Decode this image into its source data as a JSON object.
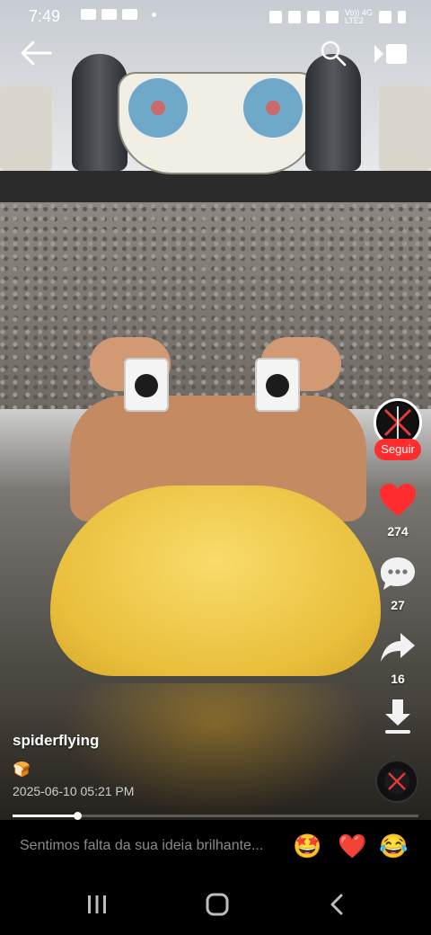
{
  "status_bar": {
    "time": "7:49",
    "network": "Vo)) 4G\nLTE2"
  },
  "top_bar": {
    "back_icon": "arrow-left-icon",
    "search_icon": "search-icon",
    "camera_icon": "video-camera-icon"
  },
  "sidebar": {
    "follow_label": "Seguir",
    "likes_count": "274",
    "comments_count": "27",
    "shares_count": "16",
    "like_color": "#ff2d2d"
  },
  "post": {
    "username": "spiderflying",
    "caption": "🍞",
    "timestamp": "2025-06-10 05:21 PM",
    "progress": 0.16
  },
  "comment_bar": {
    "placeholder": "Sentimos falta da sua ideia brilhante...",
    "emojis": [
      "🤩",
      "❤️",
      "😂"
    ]
  },
  "nav_bar": {
    "recents_icon": "recents-icon",
    "home_icon": "home-icon",
    "back_icon": "back-chevron-icon"
  }
}
